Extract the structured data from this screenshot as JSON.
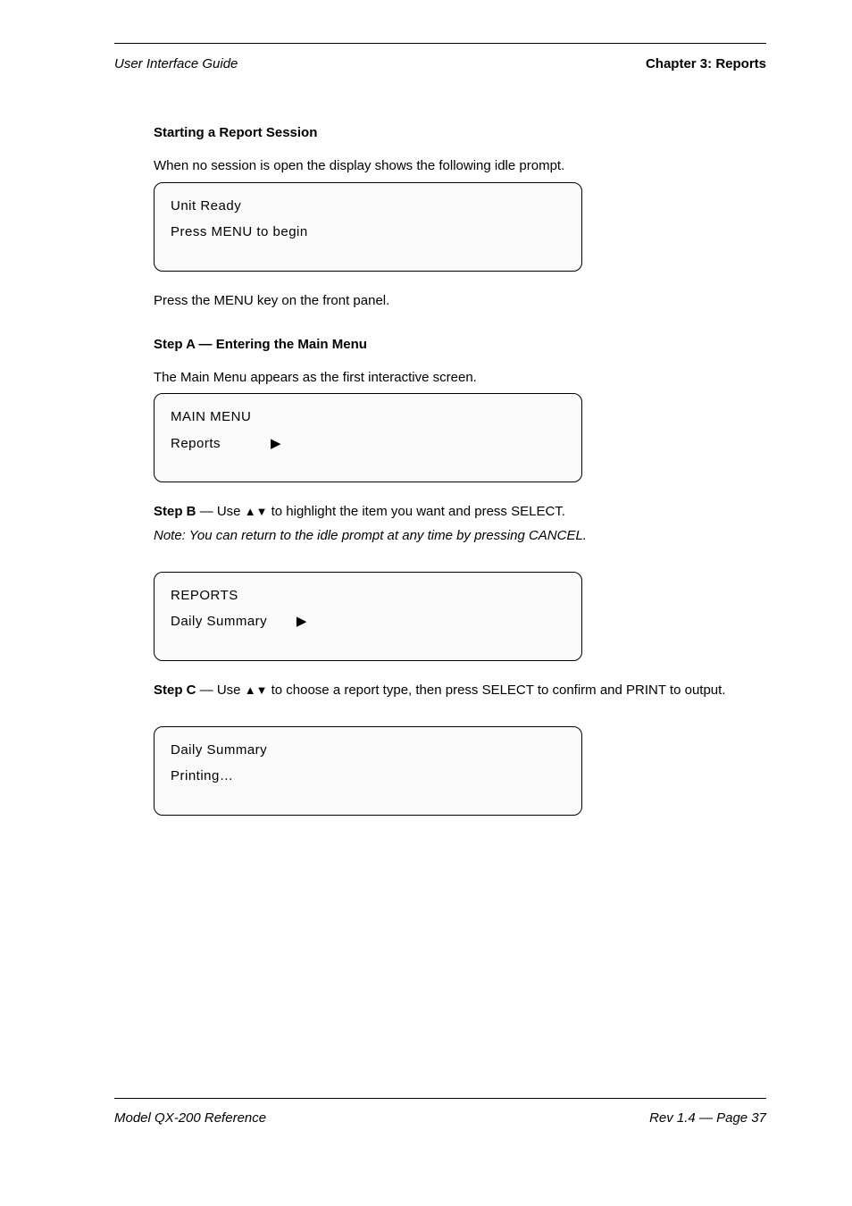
{
  "header": {
    "left": "User Interface Guide",
    "right": "Chapter 3: Reports"
  },
  "sections": [
    {
      "title": "Starting a Report Session ",
      "intro": "When no session is open the display shows the following idle prompt. ",
      "screen": {
        "line1": "Unit Ready",
        "line2": "Press MENU to begin"
      },
      "after": "Press the MENU key on the front panel. "
    },
    {
      "title": "Step A — Entering the Main Menu ",
      "intro": "The Main Menu appears as the first interactive screen. ",
      "screen": {
        "line1": "MAIN MENU",
        "line2": "Reports            ▶"
      },
      "after_prefix": "Step B",
      "after_mid": " — Use ",
      "glyph": "▲▼",
      "after_tail": " to highlight the item you want and press SELECT. ",
      "note": "Note:  You can return to the idle prompt at any time by pressing CANCEL. "
    },
    {
      "screen": {
        "line1": "REPORTS",
        "line2": "Daily Summary       ▶"
      },
      "after_prefix": "Step C",
      "after_mid": " — Use ",
      "glyph": "▲▼",
      "after_tail": " to choose a report type, then press SELECT to confirm and PRINT to output. "
    },
    {
      "screen": {
        "line1": "Daily Summary",
        "line2": "Printing…"
      }
    }
  ],
  "footer": {
    "left": "Model QX-200 Reference",
    "right": "Rev 1.4 — Page 37"
  }
}
